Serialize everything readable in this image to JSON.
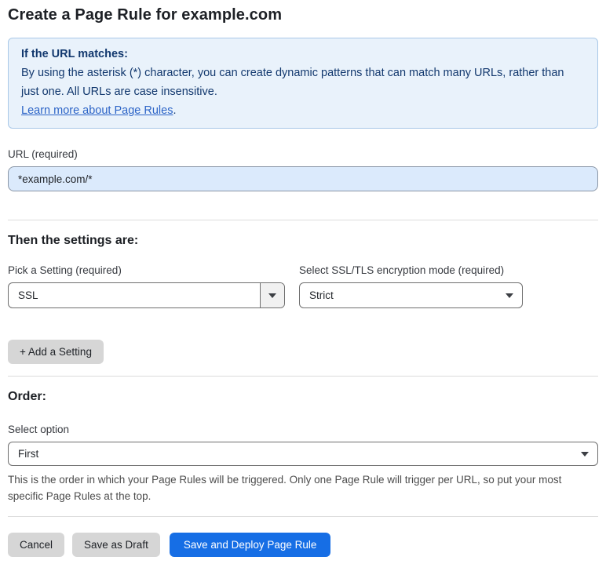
{
  "page": {
    "title": "Create a Page Rule for example.com"
  },
  "info_box": {
    "heading": "If the URL matches:",
    "body": "By using the asterisk (*) character, you can create dynamic patterns that can match many URLs, rather than just one. All URLs are case insensitive.",
    "link": "Learn more about Page Rules",
    "link_suffix": "."
  },
  "url_field": {
    "label": "URL (required)",
    "value": "*example.com/*"
  },
  "settings_section": {
    "heading": "Then the settings are:",
    "setting_picker": {
      "label": "Pick a Setting (required)",
      "value": "SSL"
    },
    "ssl_mode_picker": {
      "label": "Select SSL/TLS encryption mode (required)",
      "value": "Strict"
    },
    "add_setting_label": "+ Add a Setting"
  },
  "order_section": {
    "heading": "Order:",
    "select_label": "Select option",
    "value": "First",
    "help_text": "This is the order in which your Page Rules will be triggered. Only one Page Rule will trigger per URL, so put your most specific Page Rules at the top."
  },
  "footer": {
    "cancel_label": "Cancel",
    "save_draft_label": "Save as Draft",
    "save_deploy_label": "Save and Deploy Page Rule"
  },
  "colors": {
    "accent_blue": "#166ee5",
    "info_box_bg": "#e9f2fb",
    "info_box_border": "#a9c8e8",
    "info_box_text": "#12386e",
    "link_blue": "#2c64c7",
    "url_input_bg": "#dbeafc",
    "gray_button_bg": "#d6d6d6"
  },
  "icons": {
    "dropdown_arrow": "caret-down"
  }
}
